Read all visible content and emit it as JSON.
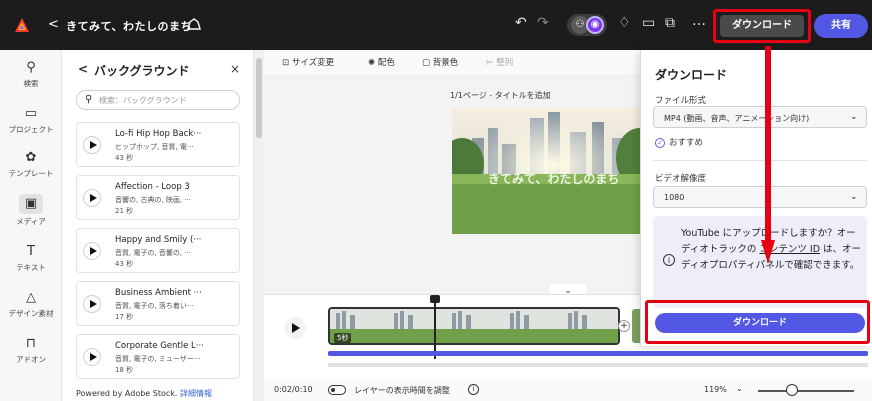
{
  "topbar": {
    "back_glyph": "<",
    "project_title": "きてみて、わたしのまち",
    "collab_initial": "",
    "collab_badge": "",
    "download_label": "ダウンロード",
    "share_label": "共有",
    "more_glyph": "…"
  },
  "rail": {
    "items": [
      {
        "label": "検索",
        "icon": "search-icon"
      },
      {
        "label": "プロジェクト",
        "icon": "folder-icon"
      },
      {
        "label": "テンプレート",
        "icon": "template-icon"
      },
      {
        "label": "メディア",
        "icon": "media-icon"
      },
      {
        "label": "テキスト",
        "icon": "text-icon"
      },
      {
        "label": "デザイン素材",
        "icon": "shapes-icon"
      },
      {
        "label": "アドオン",
        "icon": "addon-icon"
      }
    ]
  },
  "panel": {
    "back_glyph": "<",
    "title": "バックグラウンド",
    "close_glyph": "×",
    "search_placeholder": "検索：バックグラウンド",
    "tracks": [
      {
        "name": "Lo-fi Hip Hop Back···",
        "tags": "ヒップホップ, 音質, 電···",
        "duration": "43 秒"
      },
      {
        "name": "Affection - Loop 3",
        "tags": "音響の, 古典の, 映画, ···",
        "duration": "21 秒"
      },
      {
        "name": "Happy and Smily (···",
        "tags": "音質, 電子の, 音響の, ···",
        "duration": "43 秒"
      },
      {
        "name": "Business Ambient ···",
        "tags": "音質, 電子の, 落ち着い···",
        "duration": "17 秒"
      },
      {
        "name": "Corporate Gentle L···",
        "tags": "音質, 電子の, ミューザー···",
        "duration": "18 秒"
      }
    ],
    "footer_prefix": "Powered by Adobe Stock.",
    "footer_link": "詳細情報"
  },
  "toolbar": {
    "resize": "サイズ変更",
    "color": "配色",
    "background": "背景色",
    "arrange": "整列"
  },
  "canvas": {
    "page_label": "1/1ページ - タイトルを追加",
    "caption": "きてみて、わたしのまち"
  },
  "timeline": {
    "clip_duration": "5秒",
    "plus_glyph": "+"
  },
  "footer": {
    "time": "0:02/0:10",
    "toggle_label": "レイヤーの表示時間を調整",
    "zoom": "119%",
    "zoom_level": 0.35
  },
  "popover": {
    "title": "ダウンロード",
    "format_label": "ファイル形式",
    "format_value": "MP4 (動画、音声、アニメーション向け)",
    "recommended": "おすすめ",
    "resolution_label": "ビデオ解像度",
    "resolution_value": "1080",
    "notice_line1": "YouTube にアップロードしますか？オーディオトラックの",
    "notice_link": "コンテンツ ID",
    "notice_line2": "は、オーディオプロパティパネルで確認できます。",
    "download_label": "ダウンロード"
  },
  "colors": {
    "accent": "#5258e4",
    "annotation_red": "#e60012",
    "topbar": "#1c1c1c"
  }
}
